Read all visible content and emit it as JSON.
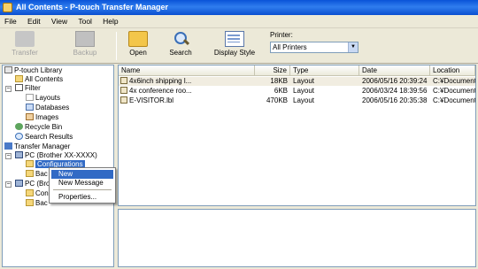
{
  "window": {
    "title": "All Contents - P-touch Transfer Manager"
  },
  "menu": [
    "File",
    "Edit",
    "View",
    "Tool",
    "Help"
  ],
  "toolbar": {
    "transfer_label": "Transfer",
    "backup_label": "Backup",
    "open_label": "Open",
    "search_label": "Search",
    "display_style_label": "Display Style",
    "printer_label": "Printer:",
    "printer_value": "All Printers"
  },
  "tree": {
    "library": "P-touch Library",
    "all_contents": "All Contents",
    "filter": "Filter",
    "layouts": "Layouts",
    "databases": "Databases",
    "images": "Images",
    "recycle_bin": "Recycle Bin",
    "search_results": "Search Results",
    "transfer_manager": "Transfer Manager",
    "pc1": "PC (Brother XX-XXXX)",
    "configurations": "Configurations",
    "bac1": "Bac",
    "pc2": "PC (Bro",
    "con2": "Con",
    "bac2": "Bac"
  },
  "context_menu": {
    "new": "New",
    "new_message": "New Message",
    "properties": "Properties..."
  },
  "table": {
    "columns": [
      "Name",
      "Size",
      "Type",
      "Date",
      "Location"
    ],
    "rows": [
      {
        "name": "4x6inch shipping l...",
        "size": "18KB",
        "type": "Layout",
        "date": "2006/05/16 20:39:24",
        "location": "C:¥Documents and ..."
      },
      {
        "name": "4x conference roo...",
        "size": "6KB",
        "type": "Layout",
        "date": "2006/03/24 18:39:56",
        "location": "C:¥Documents and ..."
      },
      {
        "name": "E-VISITOR.lbl",
        "size": "470KB",
        "type": "Layout",
        "date": "2006/05/16 20:35:38",
        "location": "C:¥Documents and ..."
      }
    ]
  }
}
